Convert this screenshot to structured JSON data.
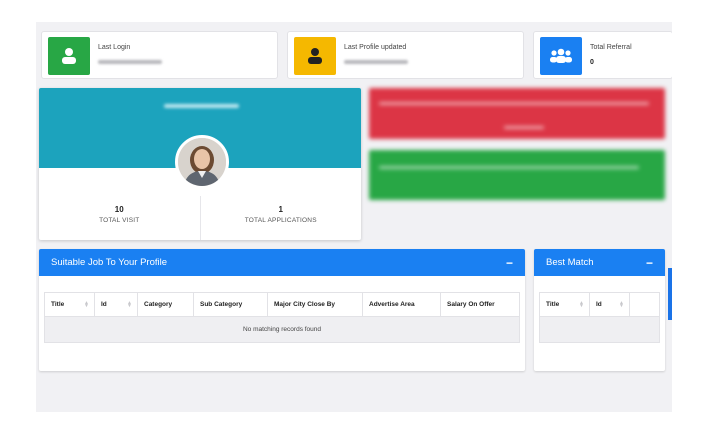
{
  "cards": {
    "last_login": {
      "label": "Last Login",
      "icon": "user-icon",
      "color": "#28a745"
    },
    "last_profile": {
      "label": "Last Profile updated",
      "icon": "user-icon",
      "color": "#f5b800"
    },
    "referral": {
      "label": "Total Referral",
      "value": "0",
      "icon": "users-icon",
      "color": "#1a80f2"
    }
  },
  "profile": {
    "visits": "10",
    "visits_label": "TOTAL VISIT",
    "applications": "1",
    "applications_label": "TOTAL APPLICATIONS"
  },
  "alerts": {
    "red": "#dc3545",
    "green": "#28a745"
  },
  "suitable_jobs": {
    "title": "Suitable Job To Your Profile",
    "collapse": "−",
    "columns": [
      "Title",
      "Id",
      "Category",
      "Sub Category",
      "Major City Close By",
      "Advertise Area",
      "Salary On Offer"
    ],
    "empty_message": "No matching records found"
  },
  "best_match": {
    "title": "Best Match",
    "collapse": "−",
    "columns": [
      "Title",
      "Id",
      ""
    ]
  },
  "colors": {
    "accent": "#1a80f2",
    "teal": "#1ca3bd"
  }
}
